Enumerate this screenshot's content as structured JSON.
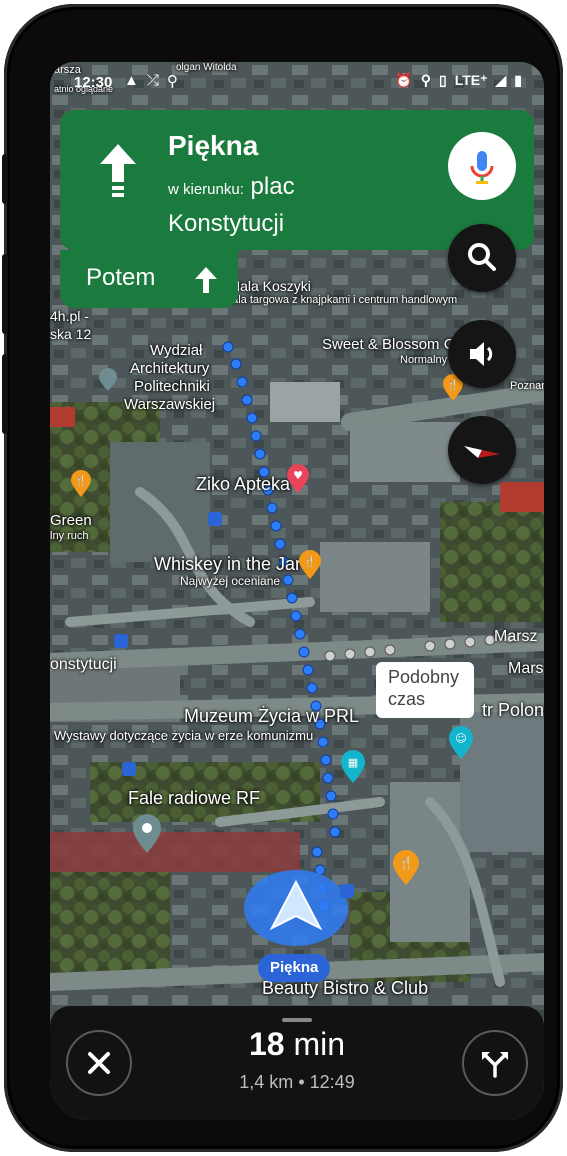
{
  "status_bar": {
    "time": "12:30",
    "network": "LTE⁺",
    "bg_text_1": "arsza",
    "bg_text_2": "atnio oglądane",
    "bg_text_3": "olgan Witolda"
  },
  "nav": {
    "street": "Piękna",
    "towards_prefix": "w kierunku:",
    "towards_main": "plac Konstytucji",
    "then_label": "Potem"
  },
  "map_labels": {
    "hala_koszyki": "Hala Koszyki",
    "hala_koszyki_desc": "hala targowa z knajpkami i centrum handlowym",
    "sweet_blossom": "Sweet & Blossom C",
    "normalny": "Normalny",
    "h_pl": "4h.pl -",
    "ska_12": "ska 12",
    "wydzial": "Wydział",
    "architektury": "Architektury",
    "politechniki": "Politechniki",
    "warszawskiej": "Warszawskiej",
    "poznan": "Poznań",
    "ziko": "Ziko Apteka",
    "green": "Green",
    "lny_ruch": "lny ruch",
    "whiskey": "Whiskey in the Jar",
    "whiskey_desc": "Najwyżej oceniane",
    "marsz_1": "Marsz",
    "marsz_2": "Mars",
    "konstytucji": "onstytucji",
    "tr_polon": "tr Polon",
    "muzeum": "Muzeum Życia w PRL",
    "muzeum_desc": "Wystawy dotyczące życia w erze komunizmu",
    "fale": "Fale radiowe RF",
    "beauty": "Beauty Bistro & Club",
    "tooltip": "Podobny czas",
    "current_street": "Piękna"
  },
  "trip": {
    "eta_value": "18",
    "eta_unit": "min",
    "distance": "1,4 km",
    "separator": "•",
    "arrival": "12:49"
  },
  "icons": {
    "mic": "mic-icon",
    "search": "search-icon",
    "sound": "volume-icon",
    "compass": "compass-icon",
    "close": "close-icon",
    "alt_routes": "alt-routes-icon"
  },
  "colors": {
    "nav_green": "#1b7a3e",
    "route_blue": "#2f7df6",
    "chip_blue": "#2a64d6"
  }
}
